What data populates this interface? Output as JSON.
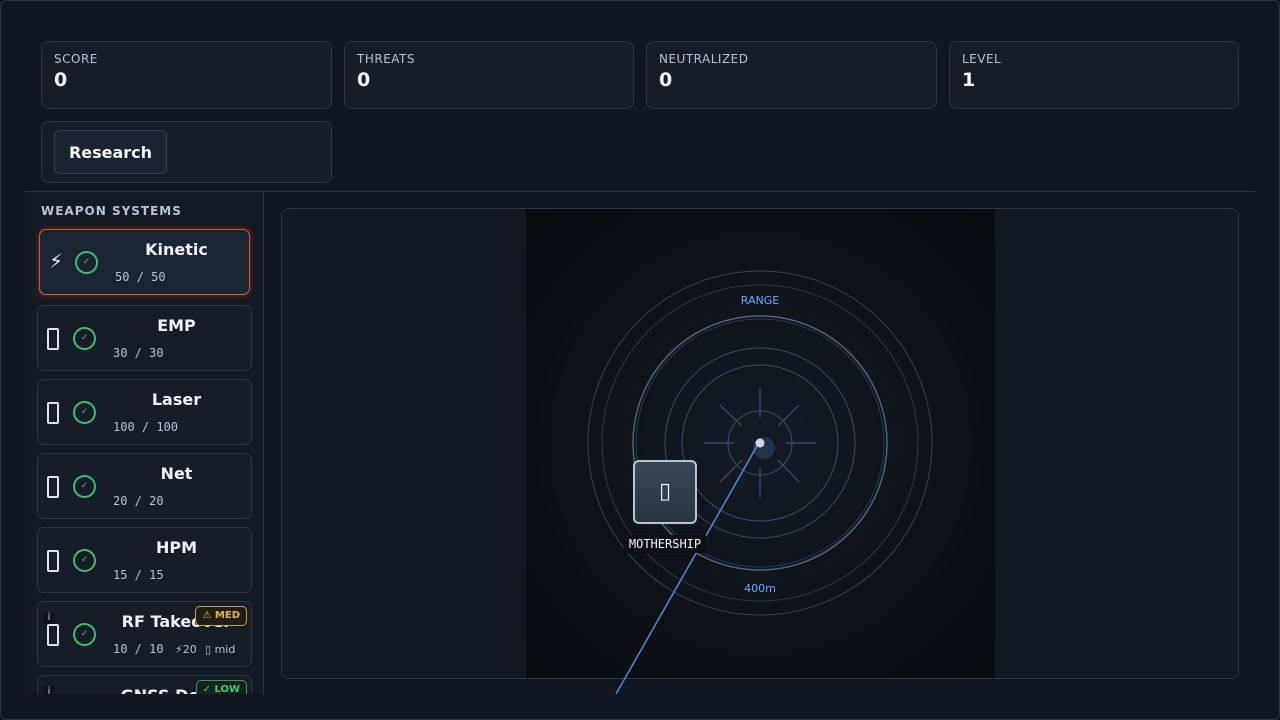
{
  "stats": {
    "score": {
      "label": "SCORE",
      "value": "0"
    },
    "threats": {
      "label": "THREATS",
      "value": "0"
    },
    "neutralized": {
      "label": "NEUTRALIZED",
      "value": "0"
    },
    "level": {
      "label": "LEVEL",
      "value": "1"
    }
  },
  "research": {
    "label": "Research"
  },
  "sidebar": {
    "title": "WEAPON SYSTEMS",
    "weapons": [
      {
        "name": "Kinetic",
        "ammo": "50 / 50",
        "icon": "lightning-icon",
        "glyph": "⚡",
        "selected": true
      },
      {
        "name": "EMP",
        "ammo": "30 / 30",
        "icon": "emp-icon"
      },
      {
        "name": "Laser",
        "ammo": "100 / 100",
        "icon": "laser-icon"
      },
      {
        "name": "Net",
        "ammo": "20 / 20",
        "icon": "net-icon"
      },
      {
        "name": "HPM",
        "ammo": "15 / 15",
        "icon": "hpm-icon"
      },
      {
        "name": "RF Takeover",
        "ammo": "10 / 10",
        "energy": "⚡20",
        "range": "mid",
        "badge": "MED",
        "icon": "rf-icon"
      },
      {
        "name": "GNSS Denial",
        "badge": "LOW",
        "icon": "gnss-icon"
      }
    ]
  },
  "arena": {
    "range_label": "RANGE",
    "distance_label": "400m",
    "mothership_label": "MOTHERSHIP"
  },
  "colors": {
    "accent_selected": "#e0572a",
    "ready": "#3bbd78",
    "badge_med": "#e4b94a",
    "badge_low": "#45c97c",
    "radar_text": "#6aa9ff"
  }
}
